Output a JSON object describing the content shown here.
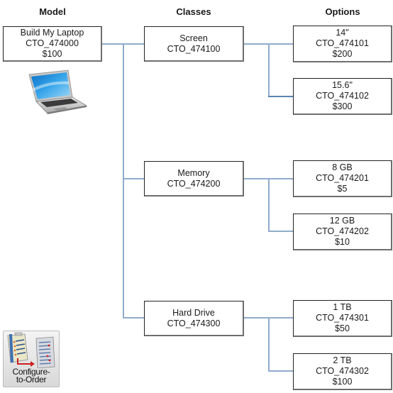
{
  "headers": {
    "model": "Model",
    "classes": "Classes",
    "options": "Options"
  },
  "model": {
    "name": "Build My Laptop",
    "code": "CTO_474000",
    "price": "$100",
    "icon": "laptop-icon"
  },
  "classes": [
    {
      "name": "Screen",
      "code": "CTO_474100",
      "options": [
        {
          "name": "14\"",
          "code": "CTO_474101",
          "price": "$200"
        },
        {
          "name": "15.6\"",
          "code": "CTO_474102",
          "price": "$300"
        }
      ]
    },
    {
      "name": "Memory",
      "code": "CTO_474200",
      "options": [
        {
          "name": "8 GB",
          "code": "CTO_474201",
          "price": "$5"
        },
        {
          "name": "12 GB",
          "code": "CTO_474202",
          "price": "$10"
        }
      ]
    },
    {
      "name": "Hard Drive",
      "code": "CTO_474300",
      "options": [
        {
          "name": "1 TB",
          "code": "CTO_474301",
          "price": "$50"
        },
        {
          "name": "2 TB",
          "code": "CTO_474302",
          "price": "$100"
        }
      ]
    }
  ],
  "badge": {
    "line1": "Configure-",
    "line2": "to-Order",
    "icon": "configure-to-order-icon"
  },
  "colors": {
    "connector": "#8faccb",
    "connector_dark": "#5a83b0",
    "box_border": "#222222"
  }
}
